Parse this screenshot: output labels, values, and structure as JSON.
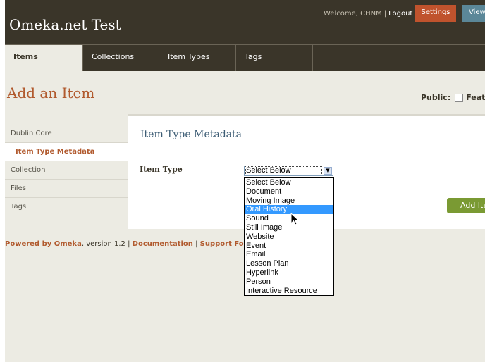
{
  "header": {
    "site_title": "Omeka.net Test",
    "welcome_text": "Welcome, CHNM",
    "separator": "|",
    "logout_label": "Logout",
    "settings_label": "Settings",
    "view_label": "View"
  },
  "nav": {
    "tabs": [
      {
        "label": "Items",
        "active": true
      },
      {
        "label": "Collections",
        "active": false
      },
      {
        "label": "Item Types",
        "active": false
      },
      {
        "label": "Tags",
        "active": false
      }
    ]
  },
  "page": {
    "title": "Add an Item",
    "public_label": "Public:",
    "featured_label": "Featu"
  },
  "sidebar": {
    "items": [
      {
        "label": "Dublin Core",
        "active": false
      },
      {
        "label": "Item Type Metadata",
        "active": true
      },
      {
        "label": "Collection",
        "active": false
      },
      {
        "label": "Files",
        "active": false
      },
      {
        "label": "Tags",
        "active": false
      }
    ]
  },
  "form": {
    "section_title": "Item Type Metadata",
    "item_type_label": "Item Type",
    "item_type_value": "Select Below",
    "add_button_label": "Add Ite"
  },
  "dropdown": {
    "highlighted": "Oral History",
    "options": [
      "Select Below",
      "Document",
      "Moving Image",
      "Oral History",
      "Sound",
      "Still Image",
      "Website",
      "Event",
      "Email",
      "Lesson Plan",
      "Hyperlink",
      "Person",
      "Interactive Resource"
    ]
  },
  "footer": {
    "powered_by": "Powered by Omeka",
    "version_text": ", version 1.2",
    "sep1": " | ",
    "documentation": "Documentation",
    "sep2": " | ",
    "support": "Support Fo"
  },
  "colors": {
    "header_bg": "#3a3529",
    "page_bg": "#ecebe3",
    "accent_orange": "#b15a2e",
    "settings_button": "#c0532d",
    "view_button": "#5b8798",
    "add_button": "#7a9a33",
    "highlight": "#3399ff",
    "section_title": "#3c5c74"
  },
  "icons": {
    "select_arrow": "chevron-down-icon",
    "cursor": "mouse-pointer-icon"
  }
}
